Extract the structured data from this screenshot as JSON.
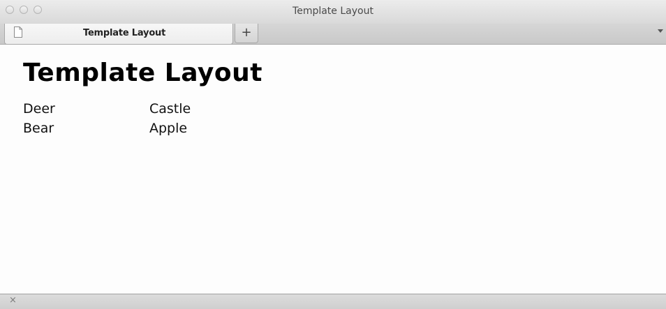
{
  "window": {
    "title": "Template Layout"
  },
  "tabs": [
    {
      "label": "Template Layout",
      "icon": "page-icon",
      "active": true
    }
  ],
  "new_tab": {
    "label": "+",
    "icon": "plus-icon"
  },
  "page": {
    "heading": "Template Layout",
    "rows": [
      {
        "col1": "Deer",
        "col2": "Castle"
      },
      {
        "col1": "Bear",
        "col2": "Apple"
      }
    ]
  },
  "statusbar": {
    "close_glyph": "×",
    "icon": "close-icon"
  }
}
